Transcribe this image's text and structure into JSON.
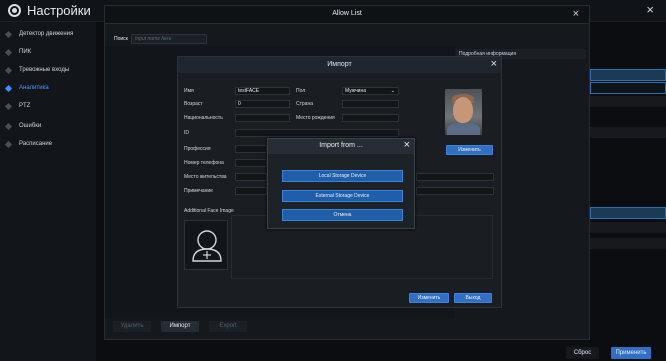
{
  "settings": {
    "title": "Настройки",
    "close_icon": "×",
    "sidebar": [
      {
        "label": "Детектор движения",
        "active": false
      },
      {
        "label": "ПИК",
        "active": false
      },
      {
        "label": "Тревожные входы",
        "active": false
      },
      {
        "label": "Аналитика",
        "active": true
      },
      {
        "label": "PTZ",
        "active": false
      },
      {
        "label": "Ошибки",
        "active": false
      },
      {
        "label": "Расписание",
        "active": false
      }
    ],
    "reset_label": "Сброс",
    "apply_label": "Применить"
  },
  "allow_list": {
    "title": "Allow List",
    "close_icon": "×",
    "search_label": "Поиск",
    "search_placeholder": "Input name here",
    "info_header": "Подробная информация",
    "delete_label": "Удалить",
    "import_label": "Импорт",
    "export_label": "Export"
  },
  "import_dialog": {
    "title": "Импорт",
    "close_icon": "×",
    "fields": {
      "name_label": "Имя",
      "name_value": "testFACE",
      "gender_label": "Пол",
      "gender_value": "Мужчина",
      "age_label": "Возраст",
      "age_value": "0",
      "country_label": "Страна",
      "nationality_label": "Национальность",
      "birthplace_label": "Место рождения",
      "id_label": "ID",
      "profession_label": "Профессия",
      "phone_label": "Номер телефона",
      "residence_label": "Место жительства",
      "note_label": "Примечание"
    },
    "change_photo_label": "Изменить",
    "additional_face_label": "Additional Face Image",
    "modify_label": "Изменить",
    "exit_label": "Выход"
  },
  "import_from": {
    "title": "Import from ...",
    "close_icon": "×",
    "local_label": "Local Storage Device",
    "external_label": "External Storage Device",
    "cancel_label": "Отмена"
  },
  "colors": {
    "accent": "#2f6fc4",
    "active_text": "#4b9bff",
    "background": "#0b0d10"
  }
}
